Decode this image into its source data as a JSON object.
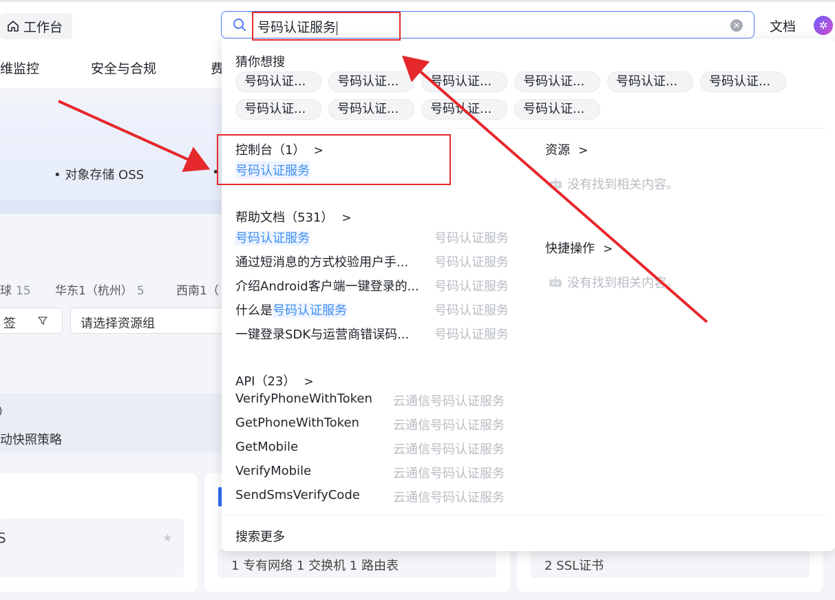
{
  "header": {
    "workbench_label": "工作台",
    "search_value": "号码认证服务",
    "doc_label": "文档"
  },
  "nav": {
    "items": [
      "维监控",
      "安全与合规",
      "费"
    ]
  },
  "background": {
    "bullets": [
      "• 对象存储 OSS",
      "•"
    ],
    "regions": [
      {
        "name": "球",
        "count": "15"
      },
      {
        "name": "华东1（杭州）",
        "count": "5"
      },
      {
        "name": "西南1（",
        "count": ""
      }
    ],
    "filter_left": "签",
    "resource_group_placeholder": "请选择资源组",
    "snap_title": ")",
    "snap_text": "动快照策略",
    "card1_title": "S",
    "card2_stats": "1 专有网络   1 交换机   1 路由表",
    "card3_stats": "2 SSL证书"
  },
  "dropdown": {
    "guess_title": "猜你想搜",
    "chips": [
      "号码认证...",
      "号码认证...",
      "号码认证...",
      "号码认证...",
      "号码认证...",
      "号码认证...",
      "号码认证...",
      "号码认证...",
      "号码认证...",
      "号码认证..."
    ],
    "console": {
      "title": "控制台（1）",
      "items": [
        "号码认证服务"
      ]
    },
    "resources": {
      "title": "资源",
      "empty": "没有找到相关内容。"
    },
    "docs": {
      "title": "帮助文档（531）",
      "items": [
        {
          "prefix": "",
          "highlight": "号码认证服务",
          "text": "",
          "source": "号码认证服务"
        },
        {
          "prefix": "",
          "highlight": "",
          "text": "通过短消息的方式校验用户手...",
          "source": "号码认证服务"
        },
        {
          "prefix": "",
          "highlight": "",
          "text": "介绍Android客户端一键登录的...",
          "source": "号码认证服务"
        },
        {
          "prefix": "什么是",
          "highlight": "号码认证服务",
          "text": "",
          "source": "号码认证服务"
        },
        {
          "prefix": "",
          "highlight": "",
          "text": "一键登录SDK与运营商错误码...",
          "source": "号码认证服务"
        }
      ]
    },
    "shortcuts": {
      "title": "快捷操作",
      "empty": "没有找到相关内容。"
    },
    "api": {
      "title": "API（23）",
      "items": [
        {
          "name": "VerifyPhoneWithToken",
          "source": "云通信号码认证服务"
        },
        {
          "name": "GetPhoneWithToken",
          "source": "云通信号码认证服务"
        },
        {
          "name": "GetMobile",
          "source": "云通信号码认证服务"
        },
        {
          "name": "VerifyMobile",
          "source": "云通信号码认证服务"
        },
        {
          "name": "SendSmsVerifyCode",
          "source": "云通信号码认证服务"
        }
      ]
    },
    "more": "搜索更多"
  },
  "colors": {
    "accent": "#4e79f5",
    "highlight": "#3d8ef0",
    "annotation_red": "#e5282b"
  }
}
